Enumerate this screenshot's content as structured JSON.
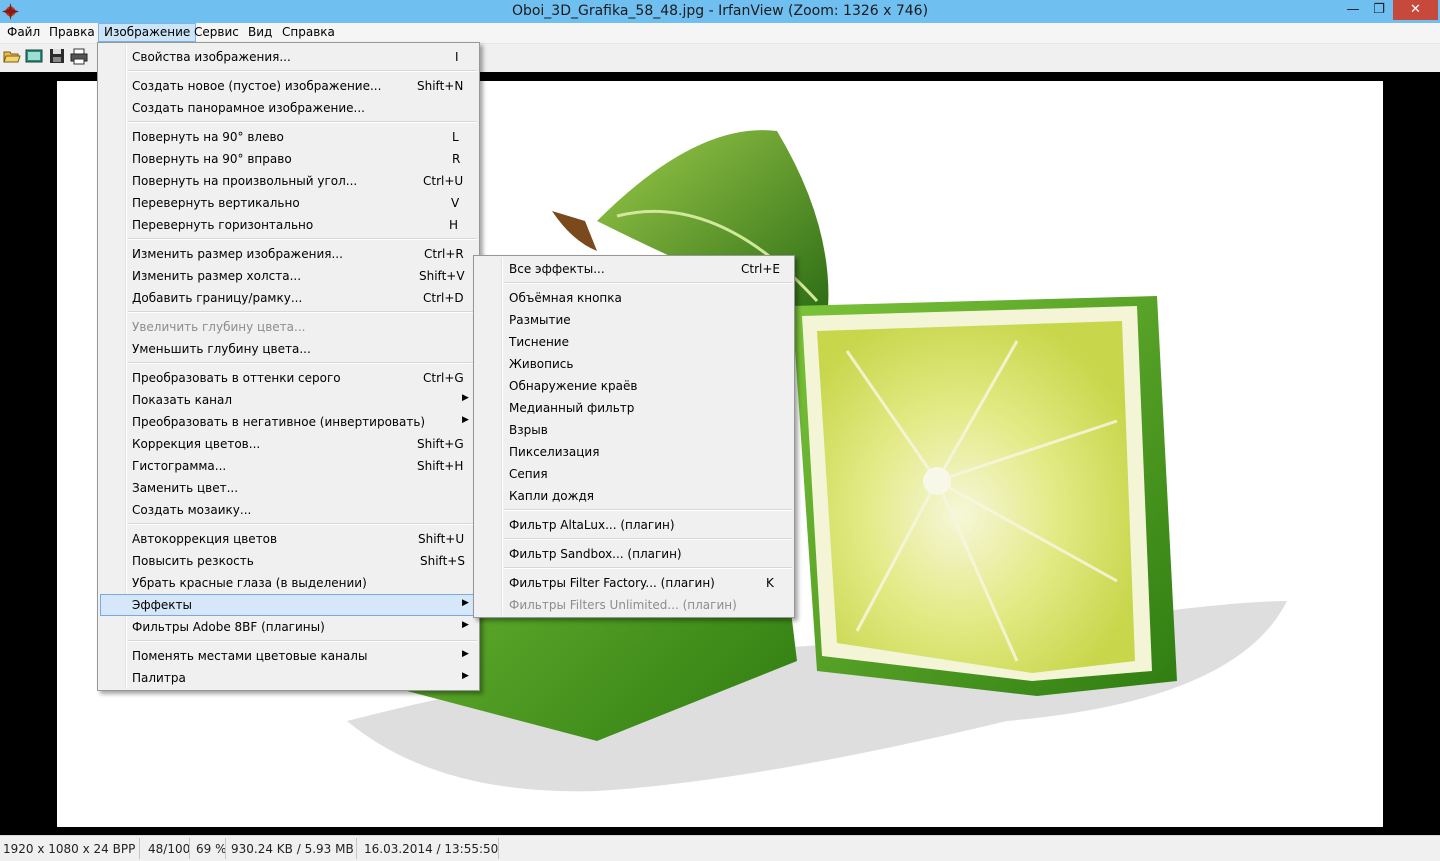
{
  "window": {
    "title": "Oboi_3D_Grafika_58_48.jpg - IrfanView (Zoom: 1326 x 746)",
    "minimize_glyph": "—",
    "maximize_glyph": "❐",
    "close_glyph": "✕"
  },
  "menubar": [
    "Файл",
    "Правка",
    "Изображение",
    "Сервис",
    "Вид",
    "Справка"
  ],
  "toolbar": {
    "icons": [
      "open-folder-icon",
      "slideshow-icon",
      "save-icon",
      "print-icon"
    ]
  },
  "image_menu": {
    "items": [
      {
        "label": "Свойства изображения...",
        "shortcut": "I"
      },
      {
        "label": "Создать новое (пустое) изображение...",
        "shortcut": "Shift+N"
      },
      {
        "label": "Создать панорамное изображение...",
        "shortcut": ""
      },
      {
        "label": "Повернуть на 90° влево",
        "shortcut": "L"
      },
      {
        "label": "Повернуть на 90° вправо",
        "shortcut": "R"
      },
      {
        "label": "Повернуть на произвольный угол...",
        "shortcut": "Ctrl+U"
      },
      {
        "label": "Перевернуть вертикально",
        "shortcut": "V"
      },
      {
        "label": "Перевернуть горизонтально",
        "shortcut": "H"
      },
      {
        "label": "Изменить размер изображения...",
        "shortcut": "Ctrl+R"
      },
      {
        "label": "Изменить размер холста...",
        "shortcut": "Shift+V"
      },
      {
        "label": "Добавить границу/рамку...",
        "shortcut": "Ctrl+D"
      },
      {
        "label": "Увеличить глубину цвета...",
        "shortcut": ""
      },
      {
        "label": "Уменьшить глубину цвета...",
        "shortcut": ""
      },
      {
        "label": "Преобразовать в оттенки серого",
        "shortcut": "Ctrl+G"
      },
      {
        "label": "Показать канал",
        "shortcut": ""
      },
      {
        "label": "Преобразовать в негативное (инвертировать)",
        "shortcut": ""
      },
      {
        "label": "Коррекция цветов...",
        "shortcut": "Shift+G"
      },
      {
        "label": "Гистограмма...",
        "shortcut": "Shift+H"
      },
      {
        "label": "Заменить цвет...",
        "shortcut": ""
      },
      {
        "label": "Создать мозаику...",
        "shortcut": ""
      },
      {
        "label": "Автокоррекция цветов",
        "shortcut": "Shift+U"
      },
      {
        "label": "Повысить резкость",
        "shortcut": "Shift+S"
      },
      {
        "label": "Убрать красные глаза (в выделении)",
        "shortcut": ""
      },
      {
        "label": "Эффекты",
        "shortcut": ""
      },
      {
        "label": "Фильтры Adobe 8BF (плагины)",
        "shortcut": ""
      },
      {
        "label": "Поменять местами цветовые каналы",
        "shortcut": ""
      },
      {
        "label": "Палитра",
        "shortcut": ""
      }
    ]
  },
  "effects_menu": {
    "items": [
      {
        "label": "Все эффекты...",
        "shortcut": "Ctrl+E"
      },
      {
        "label": "Объёмная кнопка",
        "shortcut": ""
      },
      {
        "label": "Размытие",
        "shortcut": ""
      },
      {
        "label": "Тиснение",
        "shortcut": ""
      },
      {
        "label": "Живопись",
        "shortcut": ""
      },
      {
        "label": "Обнаружение краёв",
        "shortcut": ""
      },
      {
        "label": "Медианный фильтр",
        "shortcut": ""
      },
      {
        "label": "Взрыв",
        "shortcut": ""
      },
      {
        "label": "Пикселизация",
        "shortcut": ""
      },
      {
        "label": "Сепия",
        "shortcut": ""
      },
      {
        "label": "Капли дождя",
        "shortcut": ""
      },
      {
        "label": "Фильтр AltaLux... (плагин)",
        "shortcut": ""
      },
      {
        "label": "Фильтр Sandbox... (плагин)",
        "shortcut": ""
      },
      {
        "label": "Фильтры Filter Factory... (плагин)",
        "shortcut": "K"
      },
      {
        "label": "Фильтры Filters Unlimited... (плагин)",
        "shortcut": ""
      }
    ]
  },
  "status": {
    "dimensions": "1920 x 1080 x 24 BPP",
    "index": "48/100",
    "zoom": "69 %",
    "size": "930.24 KB / 5.93 MB",
    "date": "16.03.2014 / 13:55:50"
  },
  "colors": {
    "titlebar": "#6fbff0",
    "close": "#c7493c",
    "highlight": "#d5e7f8",
    "lime_skin": "#3f9b1c",
    "lime_pulp": "#e8ee9a"
  }
}
